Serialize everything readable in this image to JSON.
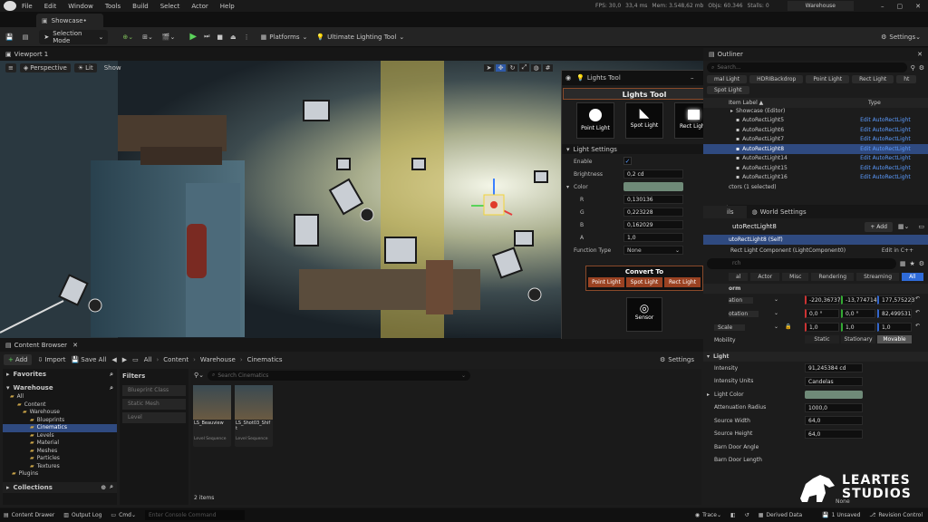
{
  "menu": {
    "items": [
      "File",
      "Edit",
      "Window",
      "Tools",
      "Build",
      "Select",
      "Actor",
      "Help"
    ],
    "stats": [
      "FPS: 30,0",
      "33,4 ms",
      "Mem: 3.548,62 mb",
      "Objs: 60.346",
      "Stalls: 0"
    ],
    "project": "Warehouse"
  },
  "tab": {
    "title": "Showcase•"
  },
  "toolbar": {
    "mode": "Selection Mode",
    "platforms": "Platforms",
    "tool": "Ultimate Lighting Tool",
    "settings": "Settings"
  },
  "viewport": {
    "tab": "Viewport 1",
    "perspective": "Perspective",
    "lit": "Lit",
    "show": "Show"
  },
  "lights_tool": {
    "window_title": "Lights Tool",
    "header": "Lights Tool",
    "types": [
      "Point Light",
      "Spot Light",
      "Rect Light"
    ],
    "section": "Light Settings",
    "enable_label": "Enable",
    "brightness_label": "Brightness",
    "brightness": "0,2 cd",
    "color_label": "Color",
    "color_swatch": "#6f8a78",
    "r_label": "R",
    "r": "0,130136",
    "g_label": "G",
    "g": "0,223228",
    "b_label": "B",
    "b": "0,162029",
    "a_label": "A",
    "a": "1,0",
    "function_label": "Function Type",
    "function": "None",
    "convert_title": "Convert To",
    "convert": [
      "Point Light",
      "Spot Light",
      "Rect Light"
    ],
    "sensor": "Sensor"
  },
  "outliner": {
    "title": "Outliner",
    "search": "Search...",
    "filters": [
      "mal Light",
      "HDRIBackdrop",
      "Point Light",
      "Rect Light",
      "ht",
      "Spot Light"
    ],
    "col_label": "Item Label ▲",
    "col_type": "Type",
    "root": "Showcase (Editor)",
    "items": [
      {
        "name": "AutoRectLight5",
        "type": "Edit AutoRectLight"
      },
      {
        "name": "AutoRectLight6",
        "type": "Edit AutoRectLight"
      },
      {
        "name": "AutoRectLight7",
        "type": "Edit AutoRectLight"
      },
      {
        "name": "AutoRectLight8",
        "type": "Edit AutoRectLight"
      },
      {
        "name": "AutoRectLight14",
        "type": "Edit AutoRectLight"
      },
      {
        "name": "AutoRectLight15",
        "type": "Edit AutoRectLight"
      },
      {
        "name": "AutoRectLight16",
        "type": "Edit AutoRectLight"
      }
    ],
    "status": "ctors (1 selected)"
  },
  "details": {
    "tab": "ils",
    "world_tab": "World Settings",
    "actor": "utoRectLight8",
    "add": "+ Add",
    "self": "utoRectLight8 (Self)",
    "component": "Rect Light Component (LightComponent0)",
    "edit_cpp": "Edit in C++",
    "search": "rch",
    "cats": [
      "al",
      "Actor",
      "Misc",
      "Rendering",
      "Streaming",
      "All"
    ],
    "transform_head": "orm",
    "loc_label": "ation",
    "loc": [
      "-220,36737",
      "-13,774714",
      "177,575223"
    ],
    "rot_label": "otation",
    "rot": [
      "0,0 °",
      "0,0 °",
      "82,499531"
    ],
    "scale_label": "Scale",
    "scale": [
      "1,0",
      "1,0",
      "1,0"
    ],
    "mob_label": "Mobility",
    "mobility": [
      "Static",
      "Stationary",
      "Movable"
    ],
    "light_head": "Light",
    "props": [
      {
        "l": "Intensity",
        "v": "91,245384 cd"
      },
      {
        "l": "Intensity Units",
        "v": "Candelas"
      },
      {
        "l": "Light Color",
        "v": ""
      },
      {
        "l": "Attenuation Radius",
        "v": "1000,0"
      },
      {
        "l": "Source Width",
        "v": "64,0"
      },
      {
        "l": "Source Height",
        "v": "64,0"
      },
      {
        "l": "Barn Door Angle",
        "v": ""
      },
      {
        "l": "Barn Door Length",
        "v": ""
      }
    ],
    "none_text": "None"
  },
  "content_browser": {
    "title": "Content Browser",
    "add": "Add",
    "import": "Import",
    "save_all": "Save All",
    "crumbs": [
      "All",
      "Content",
      "Warehouse",
      "Cinematics"
    ],
    "settings": "Settings",
    "favorites": "Favorites",
    "project": "Warehouse",
    "tree": [
      "All",
      "Content",
      "Warehouse",
      "Blueprints",
      "Cinematics",
      "Levels",
      "Material",
      "Meshes",
      "Particles",
      "Textures",
      "Plugins"
    ],
    "collections": "Collections",
    "filters": "Filters",
    "filter_items": [
      "Blueprint Class",
      "Static Mesh",
      "Level"
    ],
    "search": "Search Cinematics",
    "assets": [
      {
        "name": "LS_Beauview",
        "type": "Level Sequence"
      },
      {
        "name": "LS_Shot03_Shift",
        "type": "Level Sequence"
      }
    ],
    "count": "2 items"
  },
  "statusbar": {
    "drawer": "Content Drawer",
    "output": "Output Log",
    "cmd": "Cmd",
    "console": "Enter Console Command",
    "trace": "Trace",
    "derived": "Derived Data",
    "unsaved": "1 Unsaved",
    "revision": "Revision Control"
  },
  "watermark": {
    "line1": "LEARTES",
    "line2": "STUDIOS"
  }
}
